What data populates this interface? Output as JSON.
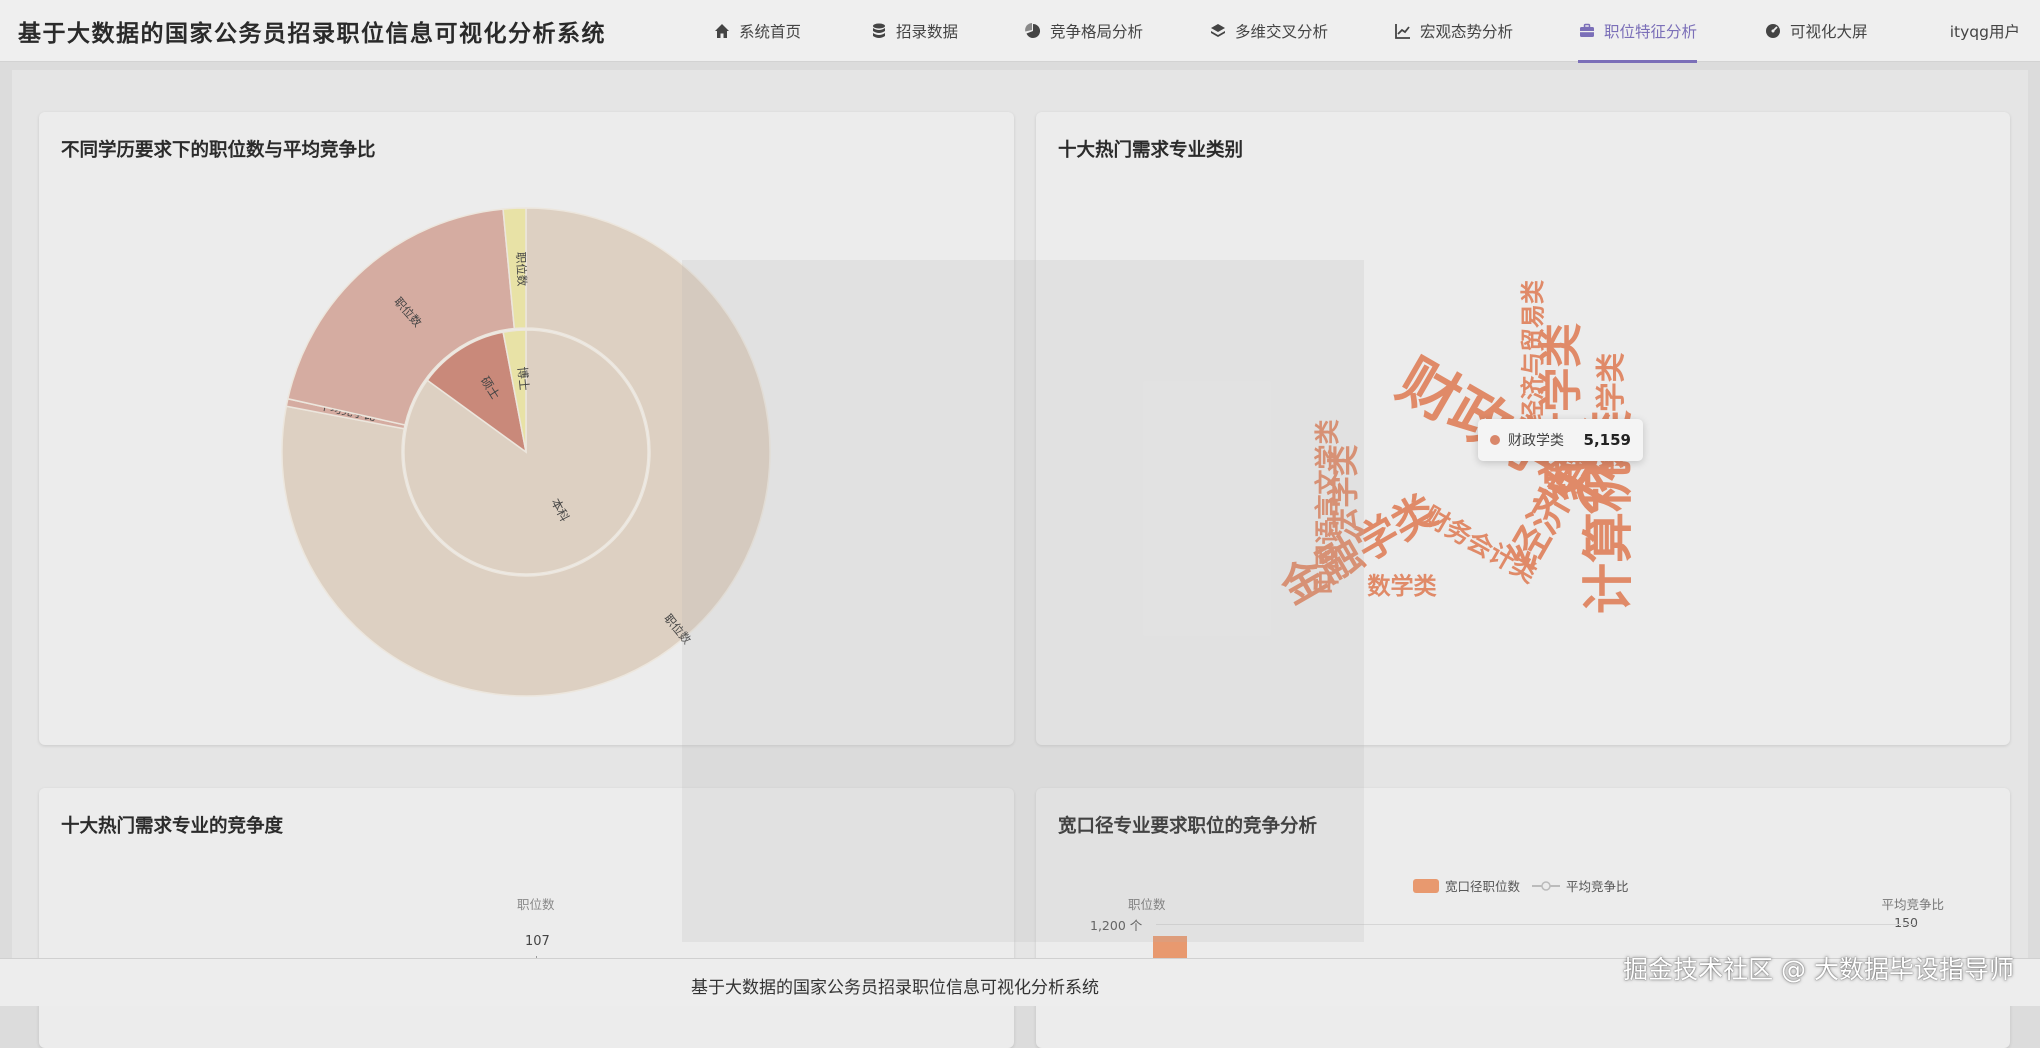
{
  "header": {
    "title": "基于大数据的国家公务员招录职位信息可视化分析系统",
    "nav": [
      {
        "label": "系统首页",
        "icon": "home-icon"
      },
      {
        "label": "招录数据",
        "icon": "database-icon"
      },
      {
        "label": "竞争格局分析",
        "icon": "pie-chart-icon"
      },
      {
        "label": "多维交叉分析",
        "icon": "layers-icon"
      },
      {
        "label": "宏观态势分析",
        "icon": "line-chart-icon"
      },
      {
        "label": "职位特征分析",
        "icon": "briefcase-icon",
        "active": true
      },
      {
        "label": "可视化大屏",
        "icon": "dashboard-icon"
      }
    ],
    "user": "ityqg用户",
    "accent_color": "#7b6fb8"
  },
  "cards": {
    "edu_title": "不同学历要求下的职位数与平均竞争比",
    "wordcloud_title": "十大热门需求专业类别",
    "competition_title": "十大热门需求专业的竞争度",
    "broad_title": "宽口径专业要求职位的竞争分析"
  },
  "chart_data": [
    {
      "type": "pie",
      "subtype": "nested-pie",
      "title": "不同学历要求下的职位数与平均竞争比",
      "inner_ring": [
        {
          "name": "本科",
          "share": 0.85,
          "color": "#ddd0c2"
        },
        {
          "name": "硕士",
          "share": 0.12,
          "color": "#c9897a"
        },
        {
          "name": "博士",
          "share": 0.03,
          "color": "#e8e2a6"
        }
      ],
      "outer_ring": [
        {
          "name": "职位数",
          "share": 0.2,
          "color": "#d5aca1"
        },
        {
          "name": "平均竞争比",
          "share": 0.005,
          "color": "#d5aca1"
        },
        {
          "name": "职位数",
          "share": 0.78,
          "color": "#ddd0c2"
        },
        {
          "name": "职位数",
          "share": 0.015,
          "color": "#e8e2a6"
        }
      ]
    },
    {
      "type": "wordcloud",
      "title": "十大热门需求专业类别",
      "words": [
        {
          "text": "财政学类",
          "value": 5159
        },
        {
          "text": "计算机类",
          "value": 4300
        },
        {
          "text": "统计学类",
          "value": 3600
        },
        {
          "text": "金融学类",
          "value": 3400
        },
        {
          "text": "经济学类",
          "value": 3100
        },
        {
          "text": "法学类",
          "value": 2200
        },
        {
          "text": "会计学类",
          "value": 2000
        },
        {
          "text": "中国语言文学类",
          "value": 1500
        },
        {
          "text": "财务会计类",
          "value": 1500
        },
        {
          "text": "经济与贸易类",
          "value": 1400
        },
        {
          "text": "数学类",
          "value": 1300
        }
      ],
      "tooltip": {
        "name": "财政学类",
        "value": "5,159"
      }
    },
    {
      "type": "bar",
      "title": "十大热门需求专业的竞争度",
      "ylabel": "职位数",
      "visible_values": [
        107
      ]
    },
    {
      "type": "bar",
      "title": "宽口径专业要求职位的竞争分析",
      "legend": [
        "宽口径职位数",
        "平均竞争比"
      ],
      "ylabel_left": "职位数",
      "ylabel_right": "平均竞争比",
      "left_tick": "1,200 个",
      "right_tick": "150"
    }
  ],
  "footer": {
    "text": "基于大数据的国家公务员招录职位信息可视化分析系统",
    "watermark": "掘金技术社区 @ 大数据毕设指导师"
  }
}
